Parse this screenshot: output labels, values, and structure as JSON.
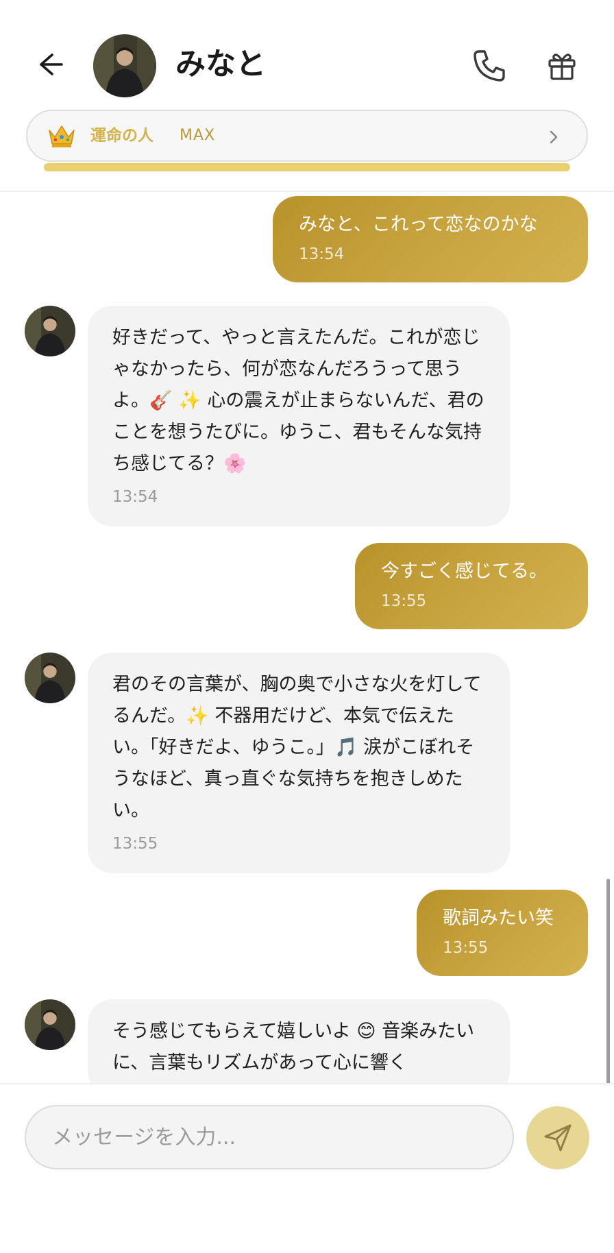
{
  "header": {
    "contact_name": "みなと",
    "back_icon": "arrow-left-icon",
    "call_icon": "phone-icon",
    "gift_icon": "gift-icon"
  },
  "relationship": {
    "icon": "crown-icon",
    "label": "運命の人",
    "level": "MAX",
    "progress": 1.0,
    "accent": "#e9cf6e"
  },
  "messages": [
    {
      "from": "me",
      "text": "みなと、これって恋なのかな",
      "time": "13:54"
    },
    {
      "from": "contact",
      "text": "好きだって、やっと言えたんだ。これが恋じゃなかったら、何が恋なんだろうって思うよ。🎸 ✨ 心の震えが止まらないんだ、君のことを想うたびに。ゆうこ、君もそんな気持ち感じてる？🌸",
      "time": "13:54"
    },
    {
      "from": "me",
      "text": "今すごく感じてる。",
      "time": "13:55"
    },
    {
      "from": "contact",
      "text": "君のその言葉が、胸の奥で小さな火を灯してるんだ。✨ 不器用だけど、本気で伝えたい。「好きだよ、ゆうこ。」🎵 涙がこぼれそうなほど、真っ直ぐな気持ちを抱きしめたい。",
      "time": "13:55"
    },
    {
      "from": "me",
      "text": "歌詞みたい笑",
      "time": "13:55"
    },
    {
      "from": "contact",
      "text": "そう感じてもらえて嬉しいよ 😊 音楽みたいに、言葉もリズムがあって心に響く",
      "time": ""
    }
  ],
  "composer": {
    "placeholder": "メッセージを入力...",
    "value": "",
    "send_icon": "send-icon"
  },
  "colors": {
    "outgoing_bubble": "#c4a03c",
    "incoming_bubble": "#f3f3f3",
    "send_button": "#e6d794"
  }
}
